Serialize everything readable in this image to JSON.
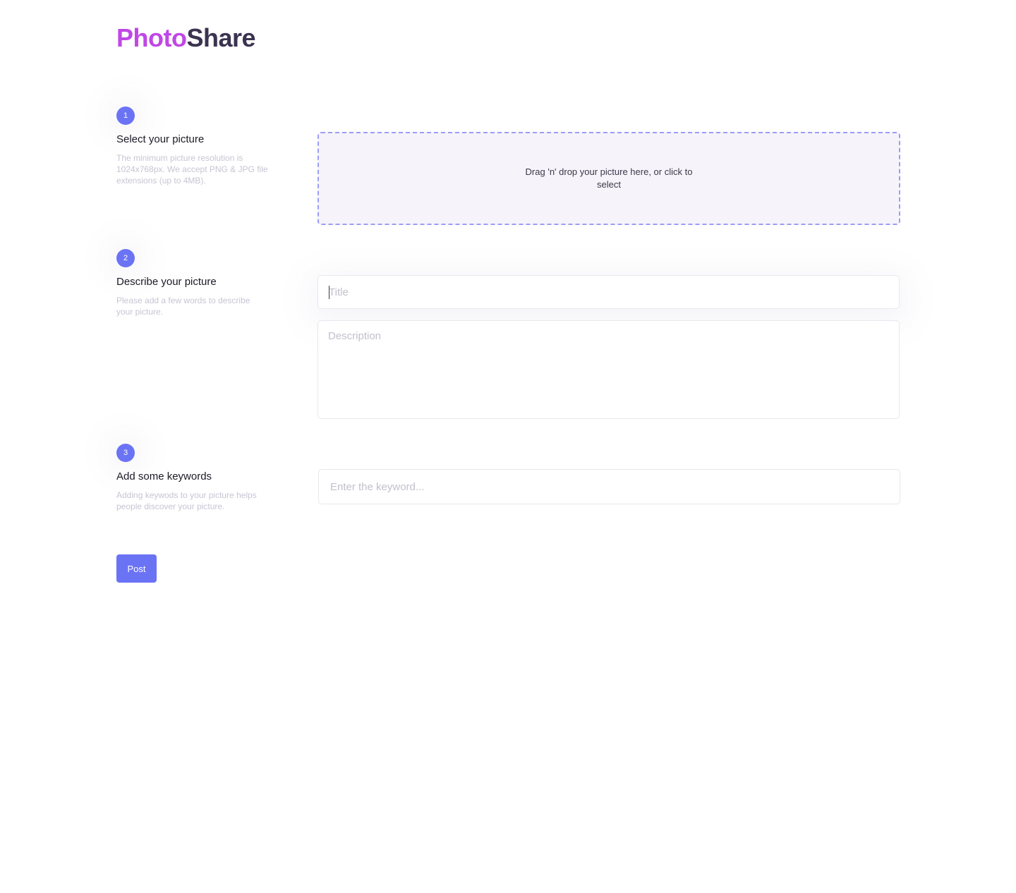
{
  "brand": {
    "part1": "Photo",
    "part2": "Share",
    "color_part1": "#c047e6",
    "color_part2": "#3b3350"
  },
  "accent_color": "#6b73f5",
  "steps": [
    {
      "number": "1",
      "title": "Select your picture",
      "description": "The minimum picture resolution is 1024x768px. We accept PNG & JPG file extensions (up to 4MB)."
    },
    {
      "number": "2",
      "title": "Describe your picture",
      "description": "Please add a few words to describe your picture."
    },
    {
      "number": "3",
      "title": "Add some keywords",
      "description": "Adding keywods to your picture helps people discover your picture."
    }
  ],
  "dropzone": {
    "text": "Drag 'n' drop your picture here, or click to select"
  },
  "form": {
    "title_placeholder": "Title",
    "title_value": "",
    "description_placeholder": "Description",
    "description_value": "",
    "keyword_placeholder": "Enter the keyword...",
    "keyword_value": ""
  },
  "actions": {
    "post_label": "Post"
  }
}
